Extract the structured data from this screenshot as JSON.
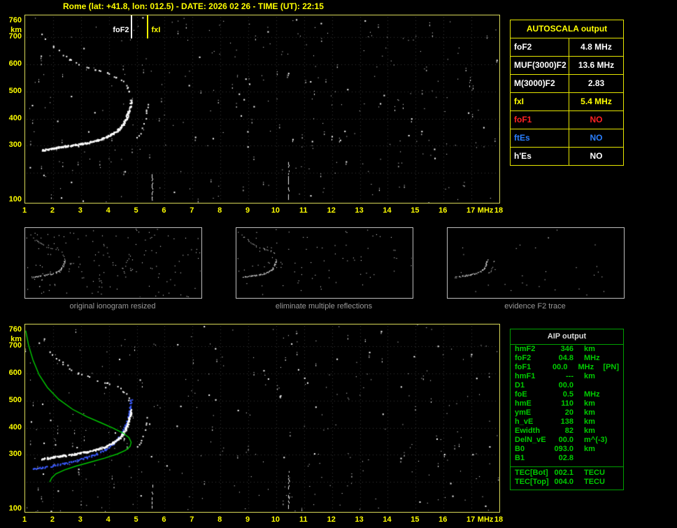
{
  "title": "Rome (lat: +41.8, lon: 012.5) - DATE: 2026 02 26 - TIME (UT): 22:15",
  "colors": {
    "accent_yellow": "#ffff00",
    "plot_border_yellow": "#d8d858",
    "aip_green": "#00cc00",
    "profile_green": "#00cc00",
    "trace_blue": "#3b5bff",
    "no_red": "#ff2222",
    "es_blue": "#2a7fff"
  },
  "autoscala_table": {
    "header": "AUTOSCALA output",
    "rows": [
      {
        "label": "foF2",
        "value": "4.8 MHz",
        "color": "#ffffff"
      },
      {
        "label": "MUF(3000)F2",
        "value": "13.6 MHz",
        "color": "#ffffff"
      },
      {
        "label": "M(3000)F2",
        "value": "2.83",
        "color": "#ffffff"
      },
      {
        "label": "fxI",
        "value": "5.4 MHz",
        "color": "#ffff00"
      },
      {
        "label": "foF1",
        "value": "NO",
        "color": "#ff2222"
      },
      {
        "label": "ftEs",
        "value": "NO",
        "color": "#2a7fff"
      },
      {
        "label": "h'Es",
        "value": "NO",
        "color": "#ffffff"
      }
    ]
  },
  "thumbnails": [
    {
      "caption": "original ionogram resized"
    },
    {
      "caption": "eliminate multiple reflections"
    },
    {
      "caption": "evidence F2 trace"
    }
  ],
  "aip_table": {
    "header": "AIP output",
    "rows": [
      {
        "label": "hmF2",
        "value": "346",
        "unit": "km",
        "extra": ""
      },
      {
        "label": "foF2",
        "value": "04.8",
        "unit": "MHz",
        "extra": ""
      },
      {
        "label": "foF1",
        "value": "00.0",
        "unit": "MHz",
        "extra": "[PN]"
      },
      {
        "label": "hmF1",
        "value": "---",
        "unit": "km",
        "extra": ""
      },
      {
        "label": "D1",
        "value": "00.0",
        "unit": "",
        "extra": ""
      },
      {
        "label": "foE",
        "value": "0.5",
        "unit": "MHz",
        "extra": ""
      },
      {
        "label": "hmE",
        "value": "110",
        "unit": "km",
        "extra": ""
      },
      {
        "label": "ymE",
        "value": "20",
        "unit": "km",
        "extra": ""
      },
      {
        "label": "h_vE",
        "value": "138",
        "unit": "km",
        "extra": ""
      },
      {
        "label": "Ewidth",
        "value": "82",
        "unit": "km",
        "extra": ""
      },
      {
        "label": "DelN_vE",
        "value": "00.0",
        "unit": "m^(-3)",
        "extra": ""
      },
      {
        "label": "B0",
        "value": "093.0",
        "unit": "km",
        "extra": ""
      },
      {
        "label": "B1",
        "value": "02.8",
        "unit": "",
        "extra": ""
      }
    ],
    "tec_rows": [
      {
        "label": "TEC[Bot]",
        "value": "002.1",
        "unit": "TECU"
      },
      {
        "label": "TEC[Top]",
        "value": "004.0",
        "unit": "TECU"
      }
    ]
  },
  "chart_data": {
    "type": "scatter",
    "title": "Rome (lat: +41.8, lon: 012.5) - DATE: 2026 02 26 - TIME (UT): 22:15",
    "x_axis": {
      "label": "MHz",
      "min": 1,
      "max": 18,
      "ticks": [
        1,
        2,
        3,
        4,
        5,
        6,
        7,
        8,
        9,
        10,
        11,
        12,
        13,
        14,
        15,
        16,
        17,
        18
      ]
    },
    "y_axis": {
      "label": "km",
      "min": 100,
      "max": 760,
      "ticks": [
        760,
        700,
        600,
        500,
        400,
        300,
        100
      ]
    },
    "markers": [
      {
        "name": "foF2",
        "freq_mhz": 4.8,
        "color": "#ffffff"
      },
      {
        "name": "fxI",
        "freq_mhz": 5.4,
        "color": "#ffff00"
      }
    ],
    "series": [
      {
        "name": "F2-layer-echo-trace",
        "color": "#ffffff",
        "points": [
          [
            1.6,
            285
          ],
          [
            2.0,
            293
          ],
          [
            2.4,
            299
          ],
          [
            2.8,
            305
          ],
          [
            3.2,
            312
          ],
          [
            3.6,
            322
          ],
          [
            3.9,
            333
          ],
          [
            4.15,
            347
          ],
          [
            4.35,
            362
          ],
          [
            4.5,
            380
          ],
          [
            4.6,
            400
          ],
          [
            4.68,
            422
          ],
          [
            4.74,
            447
          ],
          [
            4.78,
            468
          ]
        ]
      },
      {
        "name": "F2-extraordinary-trace",
        "color": "#ffffff",
        "points": [
          [
            4.95,
            325
          ],
          [
            5.1,
            345
          ],
          [
            5.2,
            368
          ],
          [
            5.28,
            395
          ],
          [
            5.33,
            425
          ],
          [
            5.37,
            455
          ]
        ]
      },
      {
        "name": "F2-second-hop-trace",
        "color": "#ffffff",
        "points": [
          [
            1.5,
            715
          ],
          [
            1.75,
            692
          ],
          [
            2.0,
            668
          ],
          [
            2.3,
            642
          ],
          [
            2.6,
            620
          ],
          [
            2.9,
            603
          ],
          [
            3.25,
            589
          ],
          [
            3.6,
            577
          ],
          [
            3.95,
            567
          ],
          [
            4.25,
            556
          ],
          [
            4.5,
            538
          ],
          [
            4.65,
            518
          ],
          [
            4.72,
            498
          ]
        ]
      }
    ],
    "interference_lines": [
      {
        "freq_mhz": 10.42,
        "km_range": [
          100,
          245
        ]
      },
      {
        "freq_mhz": 5.55,
        "km_range": [
          100,
          195
        ]
      }
    ],
    "bottom_overlays": {
      "profile": {
        "name": "electron-density-profile",
        "color": "#00cc00",
        "points": [
          [
            1.02,
            758
          ],
          [
            1.12,
            705
          ],
          [
            1.28,
            650
          ],
          [
            1.5,
            595
          ],
          [
            1.8,
            548
          ],
          [
            2.2,
            505
          ],
          [
            2.7,
            468
          ],
          [
            3.2,
            441
          ],
          [
            3.7,
            419
          ],
          [
            4.15,
            399
          ],
          [
            4.5,
            381
          ],
          [
            4.72,
            364
          ],
          [
            4.8,
            346
          ],
          [
            4.76,
            331
          ],
          [
            4.6,
            317
          ],
          [
            4.3,
            303
          ],
          [
            3.85,
            288
          ],
          [
            3.3,
            272
          ],
          [
            2.8,
            258
          ],
          [
            2.4,
            244
          ],
          [
            2.1,
            230
          ],
          [
            1.95,
            215
          ],
          [
            1.88,
            200
          ]
        ]
      },
      "restored_trace": {
        "name": "aip-scaled-trace",
        "color": "#3b5bff",
        "points": [
          [
            1.25,
            248
          ],
          [
            1.6,
            255
          ],
          [
            2.0,
            262
          ],
          [
            2.4,
            270
          ],
          [
            2.8,
            280
          ],
          [
            3.2,
            292
          ],
          [
            3.55,
            305
          ],
          [
            3.85,
            320
          ],
          [
            4.1,
            338
          ],
          [
            4.3,
            358
          ],
          [
            4.45,
            380
          ],
          [
            4.58,
            408
          ],
          [
            4.68,
            440
          ],
          [
            4.75,
            475
          ],
          [
            4.79,
            505
          ]
        ]
      }
    }
  }
}
